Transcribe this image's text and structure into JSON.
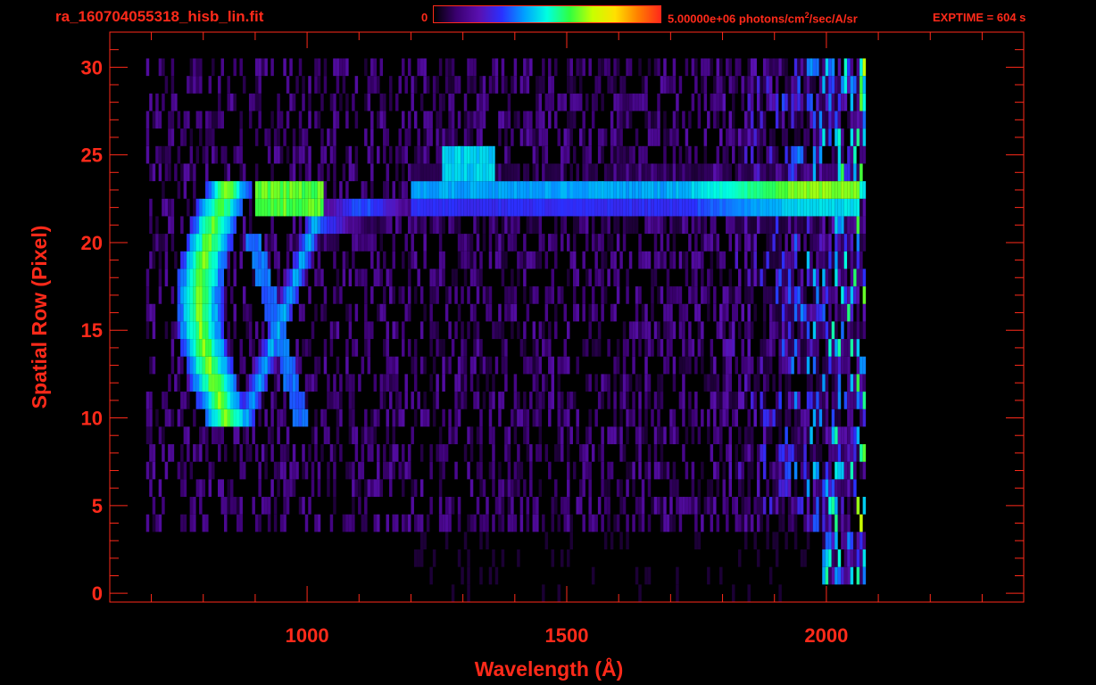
{
  "header": {
    "filename": "ra_160704055318_hisb_lin.fit",
    "colorbar_min": "0",
    "colorbar_max_prefix": "5.00000e+06 photons/cm",
    "colorbar_max_sup": "2",
    "colorbar_max_suffix": "/sec/A/sr",
    "exptime": "EXPTIME = 604 s"
  },
  "colors": {
    "axis": "#ff2a1a",
    "background": "#000000",
    "colormap": [
      "#000000",
      "#3a0070",
      "#5a10b0",
      "#2a30ff",
      "#00a0ff",
      "#00ffe0",
      "#30ff40",
      "#c8ff00",
      "#ffe000",
      "#ff8000",
      "#ff2a1a"
    ]
  },
  "chart_data": {
    "type": "heatmap",
    "xlabel": "Wavelength (Å)",
    "ylabel": "Spatial Row (Pixel)",
    "xlim": [
      620,
      2380
    ],
    "ylim": [
      -0.5,
      32
    ],
    "xticks": [
      1000,
      1500,
      2000
    ],
    "yticks": [
      0,
      5,
      10,
      15,
      20,
      25,
      30
    ],
    "colorbar_range": [
      0,
      5000000
    ],
    "features": [
      {
        "name": "emission-arc-outer",
        "rows": [
          10,
          23
        ],
        "wavelength_range": [
          790,
          920
        ]
      },
      {
        "name": "emission-arc-inner",
        "rows": [
          10,
          21
        ],
        "wavelength_range": [
          880,
          1010
        ]
      },
      {
        "name": "horizontal-band",
        "row": 23,
        "wavelength_range": [
          1200,
          2060
        ]
      },
      {
        "name": "knot",
        "row": 24.5,
        "wavelength_range": [
          1260,
          1360
        ]
      }
    ]
  }
}
